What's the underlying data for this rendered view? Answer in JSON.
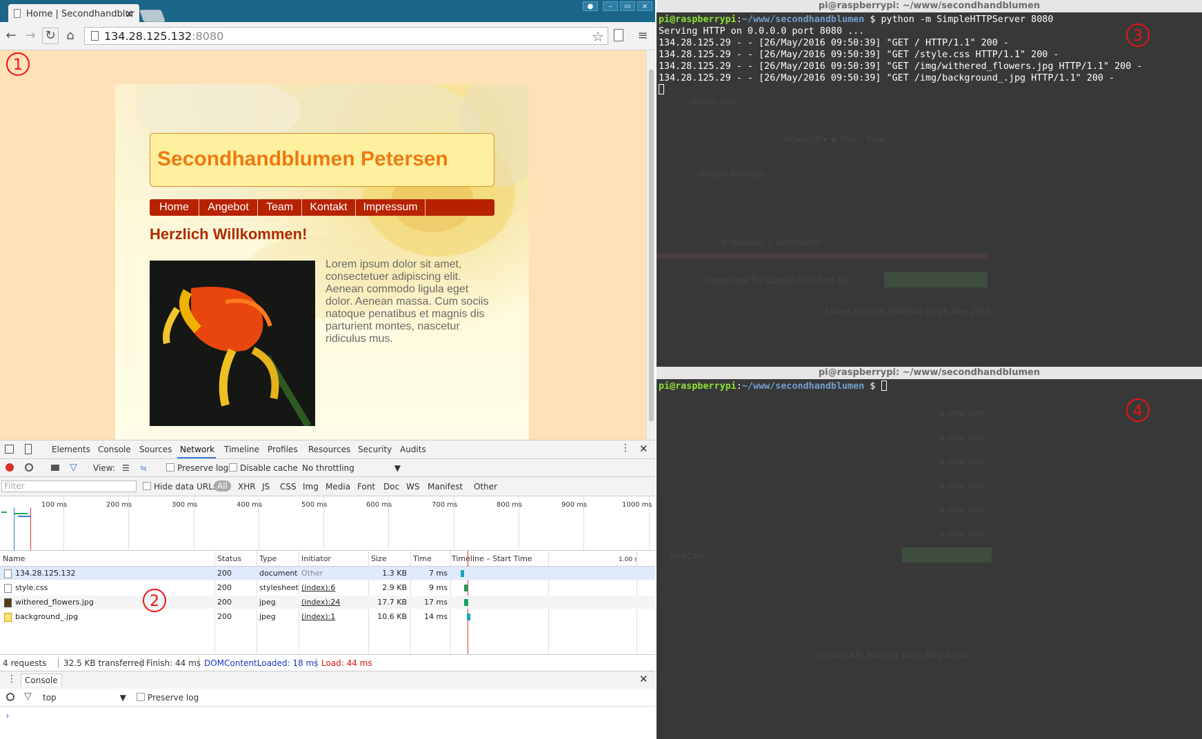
{
  "browser": {
    "tab_title": "Home | Secondhandblur",
    "url_host": "134.28.125.132",
    "url_port": ":8080"
  },
  "markers": [
    "1",
    "2",
    "3",
    "4"
  ],
  "site": {
    "title": "Secondhandblumen Petersen",
    "nav": [
      "Home",
      "Angebot",
      "Team",
      "Kontakt",
      "Impressum"
    ],
    "heading": "Herzlich Willkommen!",
    "body_text": "Lorem ipsum dolor sit amet, consectetuer adipiscing elit. Aenean commodo ligula eget dolor. Aenean massa. Cum sociis natoque penatibus et magnis dis parturient montes, nascetur ridiculus mus."
  },
  "devtools": {
    "tabs": [
      "Elements",
      "Console",
      "Sources",
      "Network",
      "Timeline",
      "Profiles",
      "Resources",
      "Security",
      "Audits"
    ],
    "active_tab": "Network",
    "toolbar": {
      "view_label": "View:",
      "preserve_log": "Preserve log",
      "disable_cache": "Disable cache",
      "throttling": "No throttling"
    },
    "filterbar": {
      "placeholder": "Filter",
      "hide_data_urls": "Hide data URLs",
      "types": [
        "All",
        "XHR",
        "JS",
        "CSS",
        "Img",
        "Media",
        "Font",
        "Doc",
        "WS",
        "Manifest",
        "Other"
      ]
    },
    "overview_ticks": [
      "100 ms",
      "200 ms",
      "300 ms",
      "400 ms",
      "500 ms",
      "600 ms",
      "700 ms",
      "800 ms",
      "900 ms",
      "1000 ms"
    ],
    "columns": [
      "Name",
      "Status",
      "Type",
      "Initiator",
      "Size",
      "Time",
      "Timeline – Start Time"
    ],
    "timeline_scale": "1.00 s",
    "requests": [
      {
        "name": "134.28.125.132",
        "status": "200",
        "type": "document",
        "initiator": "Other",
        "size": "1.3 KB",
        "time": "7 ms"
      },
      {
        "name": "style.css",
        "status": "200",
        "type": "stylesheet",
        "initiator": "(index):6",
        "size": "2.9 KB",
        "time": "9 ms"
      },
      {
        "name": "withered_flowers.jpg",
        "status": "200",
        "type": "jpeg",
        "initiator": "(index):24",
        "size": "17.7 KB",
        "time": "17 ms"
      },
      {
        "name": "background_.jpg",
        "status": "200",
        "type": "jpeg",
        "initiator": "(index):1",
        "size": "10.6 KB",
        "time": "14 ms"
      }
    ],
    "summary": {
      "requests": "4 requests",
      "transferred": "32.5 KB transferred",
      "finish": "Finish: 44 ms",
      "dcl": "DOMContentLoaded: 18 ms",
      "load": "Load: 44 ms"
    },
    "drawer": {
      "tab": "Console",
      "context": "top",
      "preserve_log": "Preserve log",
      "prompt": "›"
    }
  },
  "terminal_top": {
    "title": "pi@raspberrypi: ~/www/secondhandblumen",
    "prompt_user": "pi@raspberrypi",
    "prompt_sep": ":",
    "prompt_path": "~/www/secondhandblumen",
    "prompt_end": " $ ",
    "command": "python -m SimpleHTTPServer 8080",
    "output": [
      "Serving HTTP on 0.0.0.0 port 8080 ...",
      "134.28.125.29 - - [26/May/2016 09:50:39] \"GET / HTTP/1.1\" 200 -",
      "134.28.125.29 - - [26/May/2016 09:50:39] \"GET /style.css HTTP/1.1\" 200 -",
      "134.28.125.29 - - [26/May/2016 09:50:39] \"GET /img/withered_flowers.jpg HTTP/1.1\" 200 -",
      "134.28.125.29 - - [26/May/2016 09:50:39] \"GET /img/background_.jpg HTTP/1.1\" 200 -"
    ]
  },
  "terminal_bottom": {
    "title": "pi@raspberrypi: ~/www/secondhandblumen",
    "prompt_user": "pi@raspberrypi",
    "prompt_sep": ":",
    "prompt_path": "~/www/secondhandblumen",
    "prompt_end": " $ "
  },
  "colors": {
    "accent_blue": "#1b6688",
    "site_orange": "#ee7a10",
    "nav_red": "#b72200",
    "terminal_bg": "#383838",
    "prompt_green": "#8ae234",
    "prompt_blue": "#729fcf"
  }
}
